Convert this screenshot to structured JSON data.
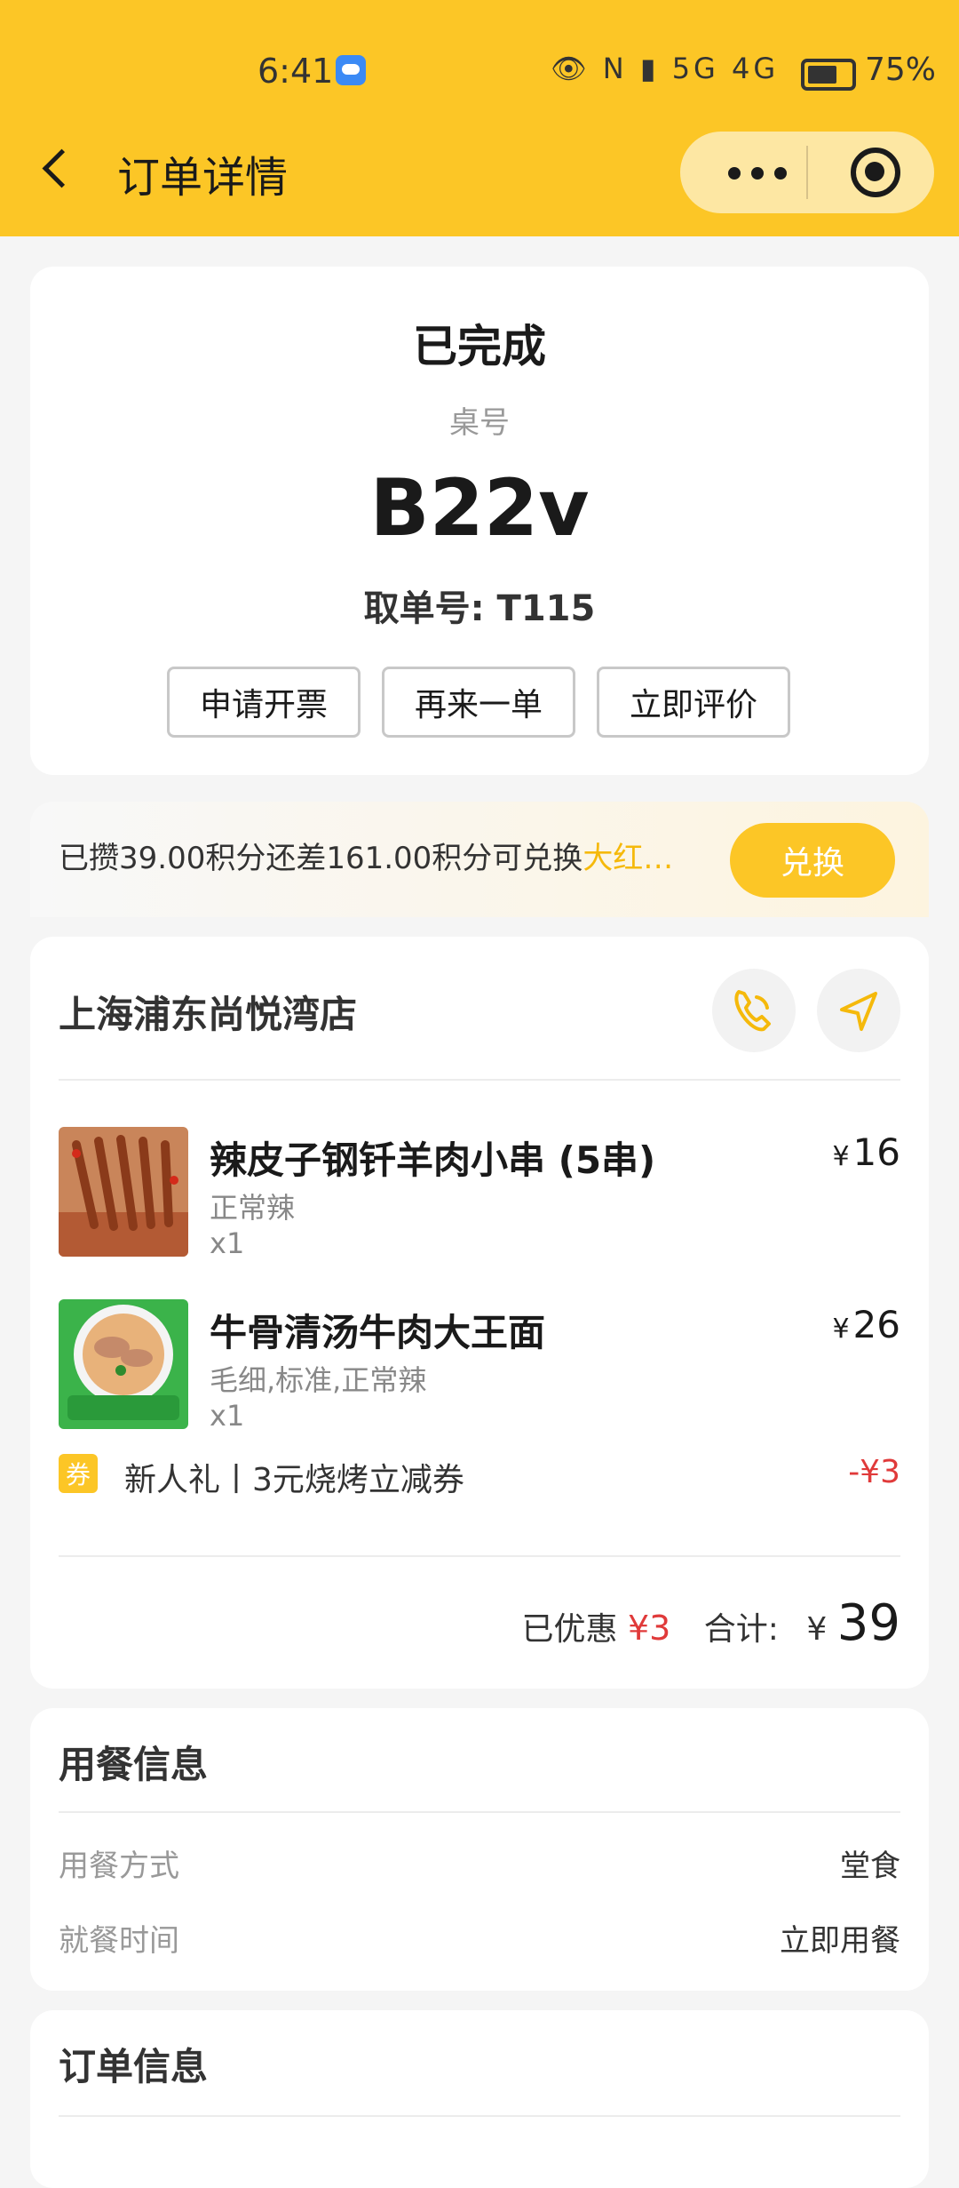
{
  "status_bar": {
    "time": "6:41",
    "signal_icons": "👁 N ▮ 5G 4G",
    "battery_pct": "75%"
  },
  "header": {
    "title": "订单详情"
  },
  "order": {
    "status": "已完成",
    "table_label": "桌号",
    "table_no": "B22v",
    "pickup_no": "取单号: T115",
    "actions": [
      "申请开票",
      "再来一单",
      "立即评价"
    ]
  },
  "points": {
    "text_prefix": "已攒39.00积分还差161.00积分可兑换",
    "text_highlight": "大红…",
    "redeem_label": "兑换"
  },
  "store": {
    "name": "上海浦东尚悦湾店",
    "items": [
      {
        "name": "辣皮子钢钎羊肉小串 (5串)",
        "spec": "正常辣",
        "qty": "x1",
        "currency": "¥",
        "price": "16"
      },
      {
        "name": "牛骨清汤牛肉大王面",
        "spec": "毛细,标准,正常辣",
        "qty": "x1",
        "currency": "¥",
        "price": "26"
      }
    ],
    "coupon": {
      "badge": "券",
      "text": "新人礼丨3元烧烤立减券",
      "amount": "-¥3"
    },
    "discount_label": "已优惠",
    "discount_value": "¥3",
    "total_label": "合计:",
    "total_currency": "¥",
    "total_value": "39"
  },
  "dine_info": {
    "title": "用餐信息",
    "rows": [
      {
        "key": "用餐方式",
        "value": "堂食"
      },
      {
        "key": "就餐时间",
        "value": "立即用餐"
      }
    ]
  },
  "order_info": {
    "title": "订单信息"
  },
  "colors": {
    "accent": "#fcc626",
    "discount_red": "#e03a3a"
  }
}
